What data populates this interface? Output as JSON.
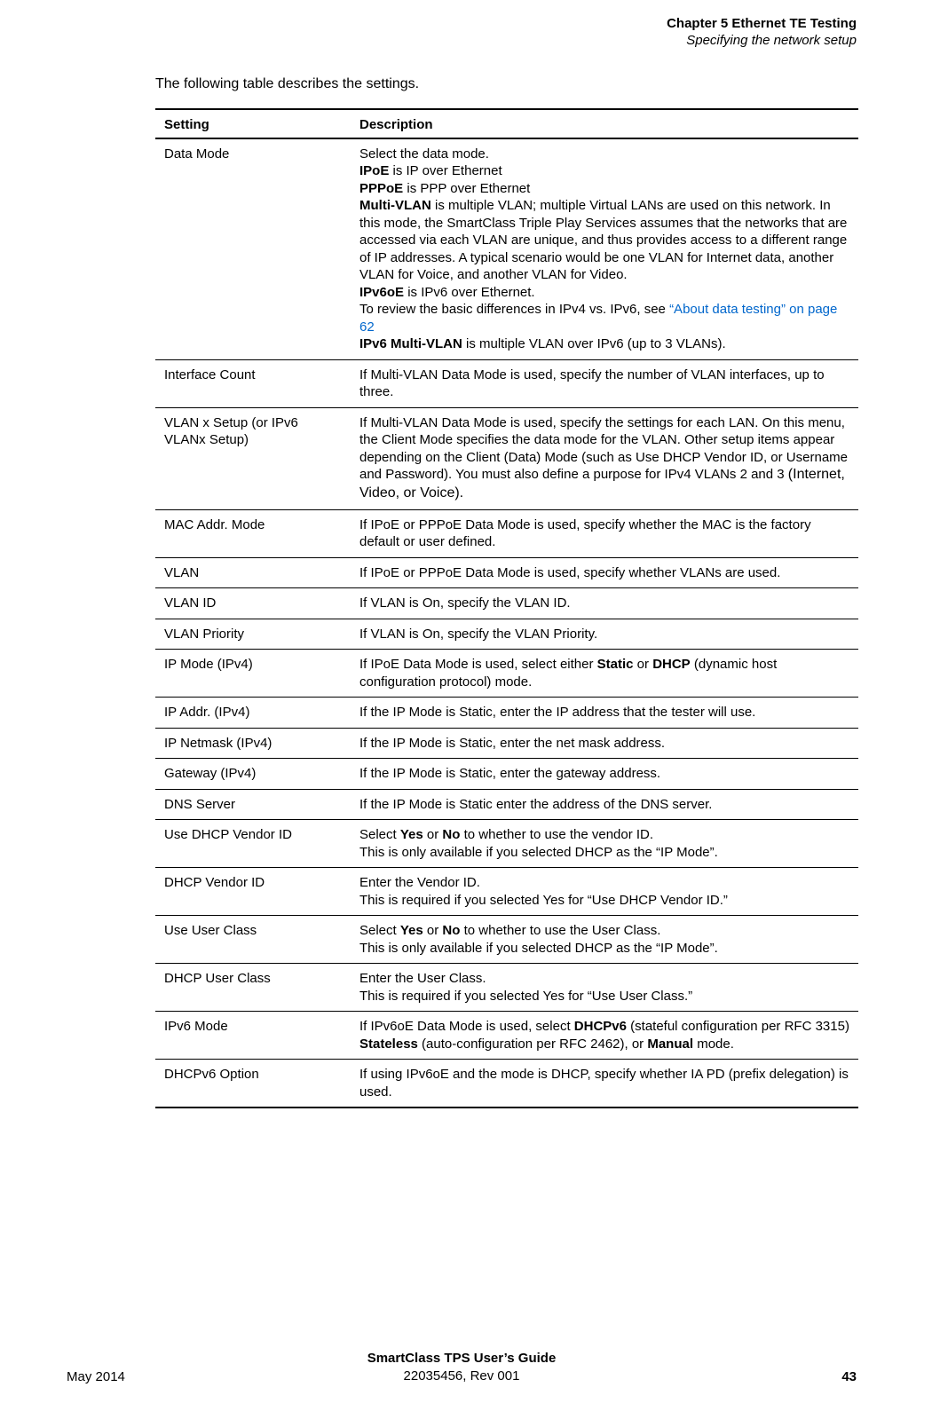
{
  "header": {
    "chapter": "Chapter 5  Ethernet TE Testing",
    "section": "Specifying the network setup"
  },
  "intro": "The following table describes the settings.",
  "columns": {
    "setting": "Setting",
    "description": "Description"
  },
  "rows": {
    "data_mode": {
      "setting": "Data Mode",
      "d1": "Select the data mode.",
      "d2a": "IPoE",
      "d2b": " is IP over Ethernet",
      "d3a": "PPPoE",
      "d3b": " is PPP over Ethernet",
      "d4a": "Multi-VLAN",
      "d4b": " is multiple VLAN; multiple Virtual LANs are used on this network. In this mode, the SmartClass Triple Play Services assumes that the networks that are accessed via each VLAN are unique, and thus provides access to a different range of IP addresses. A typical scenario would be one VLAN for Internet data, another VLAN for Voice, and another VLAN for Video.",
      "d5a": "IPv6oE",
      "d5b": " is IPv6 over Ethernet.",
      "d6a": "To review the basic differences in IPv4 vs. IPv6, see ",
      "d6b": "“About data testing” on page 62",
      "d7a": "IPv6 Multi-VLAN",
      "d7b": " is multiple VLAN over IPv6 (up to 3 VLANs)."
    },
    "interface_count": {
      "setting": "Interface Count",
      "desc": "If Multi-VLAN Data Mode is used, specify the number of VLAN interfaces, up to three."
    },
    "vlanx": {
      "setting": "VLAN x Setup (or IPv6 VLANx Setup)",
      "d1": "If Multi-VLAN Data Mode is used, specify the settings for each LAN. On this menu, the Client Mode specifies the data mode for the VLAN. Other setup items appear depending on the Client (Data) Mode (such as Use DHCP Vendor ID, or Username and Password). You must also define a purpose for IPv4 VLANs 2 and 3 ",
      "d2": "(Internet, Video, or Voice)."
    },
    "mac": {
      "setting": "MAC Addr. Mode",
      "desc": "If IPoE or PPPoE Data Mode is used, specify whether the MAC is the factory default or user defined."
    },
    "vlan": {
      "setting": "VLAN",
      "desc": "If IPoE or PPPoE Data Mode is used, specify whether VLANs are used."
    },
    "vlan_id": {
      "setting": "VLAN ID",
      "desc": "If VLAN is On, specify the VLAN ID."
    },
    "vlan_pri": {
      "setting": "VLAN Priority",
      "desc": "If VLAN is On, specify the VLAN Priority."
    },
    "ip_mode": {
      "setting": "IP Mode (IPv4)",
      "d1": "If IPoE Data Mode is used, select either ",
      "d2": "Static",
      "d3": " or ",
      "d4": "DHCP",
      "d5": " (dynamic host configuration protocol) mode."
    },
    "ip_addr": {
      "setting": "IP Addr. (IPv4)",
      "desc": "If the IP Mode is Static, enter the IP address that the tester will use."
    },
    "ip_netmask": {
      "setting": "IP Netmask (IPv4)",
      "desc": "If the IP Mode is Static, enter the net mask address."
    },
    "gateway": {
      "setting": "Gateway (IPv4)",
      "desc": "If the IP Mode is Static, enter the gateway address."
    },
    "dns": {
      "setting": "DNS Server",
      "desc": "If the IP Mode is Static enter the address of the DNS server."
    },
    "use_vendor": {
      "setting": "Use DHCP Vendor ID",
      "d1": "Select ",
      "d2": "Yes",
      "d3": " or ",
      "d4": "No",
      "d5": " to whether to use the vendor ID.",
      "d6": "This is only available if you selected DHCP as the “IP Mode”."
    },
    "vendor_id": {
      "setting": "DHCP Vendor ID",
      "d1": "Enter the Vendor ID.",
      "d2": "This is required if you selected Yes for “Use DHCP Vendor ID.”"
    },
    "use_user_class": {
      "setting": "Use User Class",
      "d1": "Select ",
      "d2": "Yes",
      "d3": " or ",
      "d4": "No",
      "d5": " to whether to use the User Class.",
      "d6": "This is only available if you selected DHCP as the “IP Mode”."
    },
    "user_class": {
      "setting": "DHCP User Class",
      "d1": "Enter the User Class.",
      "d2": "This is required if you selected Yes for “Use User Class.”"
    },
    "ipv6_mode": {
      "setting": "IPv6 Mode",
      "d1": "If IPv6oE Data Mode is used, select ",
      "d2": "DHCPv6",
      "d3": " (stateful configuration per RFC 3315) ",
      "d4": "Stateless",
      "d5": " (auto-configuration per RFC 2462), or ",
      "d6": "Manual",
      "d7": " mode."
    },
    "dhcpv6_opt": {
      "setting": "DHCPv6 Option",
      "desc": "If using IPv6oE and the mode is DHCP, specify whether IA PD (prefix delegation) is used."
    }
  },
  "footer": {
    "title": "SmartClass TPS User’s Guide",
    "docnum": "22035456, Rev 001",
    "date": "May 2014",
    "page": "43"
  }
}
